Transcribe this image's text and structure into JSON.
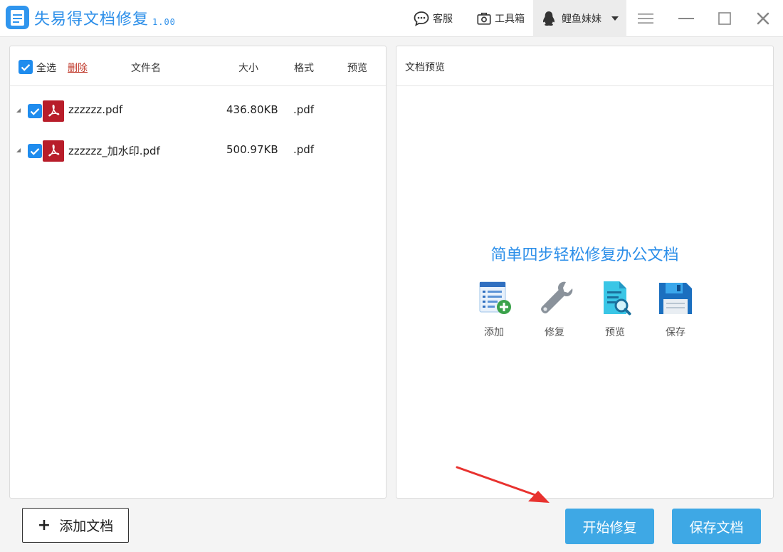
{
  "app": {
    "title": "失易得文档修复",
    "version": "1.00"
  },
  "titlebar": {
    "support_label": "客服",
    "toolbox_label": "工具箱",
    "username": "鲤鱼妹妹"
  },
  "file_list": {
    "select_all_label": "全选",
    "delete_label": "删除",
    "columns": {
      "name": "文件名",
      "size": "大小",
      "format": "格式",
      "preview": "预览"
    },
    "rows": [
      {
        "name": "zzzzzz.pdf",
        "size": "436.80KB",
        "format": ".pdf",
        "checked": true
      },
      {
        "name": "zzzzzz_加水印.pdf",
        "size": "500.97KB",
        "format": ".pdf",
        "checked": true
      }
    ]
  },
  "preview": {
    "title": "文档预览",
    "slogan": "简单四步轻松修复办公文档",
    "steps": [
      {
        "label": "添加",
        "icon": "add-document-icon"
      },
      {
        "label": "修复",
        "icon": "wrench-icon"
      },
      {
        "label": "预览",
        "icon": "preview-document-icon"
      },
      {
        "label": "保存",
        "icon": "floppy-disk-icon"
      }
    ]
  },
  "actions": {
    "add_document": "添加文档",
    "start_repair": "开始修复",
    "save_document": "保存文档"
  },
  "colors": {
    "accent": "#2d8fe9",
    "button_blue": "#3ea8e5",
    "pdf_red": "#b81d2a",
    "delete_red": "#c0392b",
    "arrow_red": "#e8322f"
  }
}
